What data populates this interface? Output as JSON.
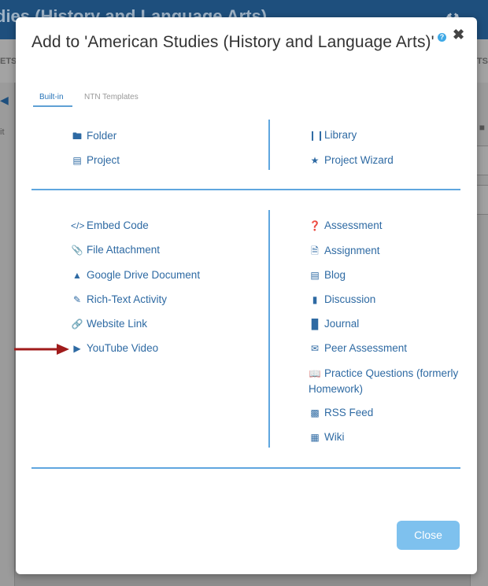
{
  "background": {
    "header_title": "dies (History and Language Arts)",
    "tab_left": "ETS",
    "tab_right": "ETS"
  },
  "modal": {
    "title": "Add to 'American Studies (History and Language Arts)'",
    "help_icon": "?",
    "close_icon": "✖",
    "tabs": [
      {
        "label": "Built-in",
        "active": true
      },
      {
        "label": "NTN Templates",
        "active": false
      }
    ],
    "section1": {
      "left": [
        {
          "icon": "folder-icon",
          "label": "Folder"
        },
        {
          "icon": "project-icon",
          "label": "Project"
        }
      ],
      "right": [
        {
          "icon": "library-icon",
          "label": "Library"
        },
        {
          "icon": "star-icon",
          "label": "Project Wizard"
        }
      ]
    },
    "section2": {
      "left": [
        {
          "icon": "code-icon",
          "label": "Embed Code"
        },
        {
          "icon": "paperclip-icon",
          "label": "File Attachment"
        },
        {
          "icon": "google-drive-icon",
          "label": "Google Drive Document"
        },
        {
          "icon": "pencil-icon",
          "label": "Rich-Text Activity"
        },
        {
          "icon": "link-icon",
          "label": "Website Link"
        },
        {
          "icon": "youtube-icon",
          "label": "YouTube Video"
        }
      ],
      "right": [
        {
          "icon": "question-circle-icon",
          "label": "Assessment"
        },
        {
          "icon": "document-icon",
          "label": "Assignment"
        },
        {
          "icon": "blog-icon",
          "label": "Blog"
        },
        {
          "icon": "comment-icon",
          "label": "Discussion"
        },
        {
          "icon": "journal-icon",
          "label": "Journal"
        },
        {
          "icon": "peer-assessment-icon",
          "label": "Peer Assessment"
        },
        {
          "icon": "book-open-icon",
          "label": "Practice Questions (formerly Homework)"
        },
        {
          "icon": "rss-icon",
          "label": "RSS Feed"
        },
        {
          "icon": "wiki-icon",
          "label": "Wiki"
        }
      ]
    },
    "close_button": "Close"
  },
  "colors": {
    "link": "#2e6aa3",
    "divider": "#5fa6df",
    "close_button": "#7ec1ee",
    "arrow": "#a01b1b",
    "header": "#1e4f7d"
  }
}
